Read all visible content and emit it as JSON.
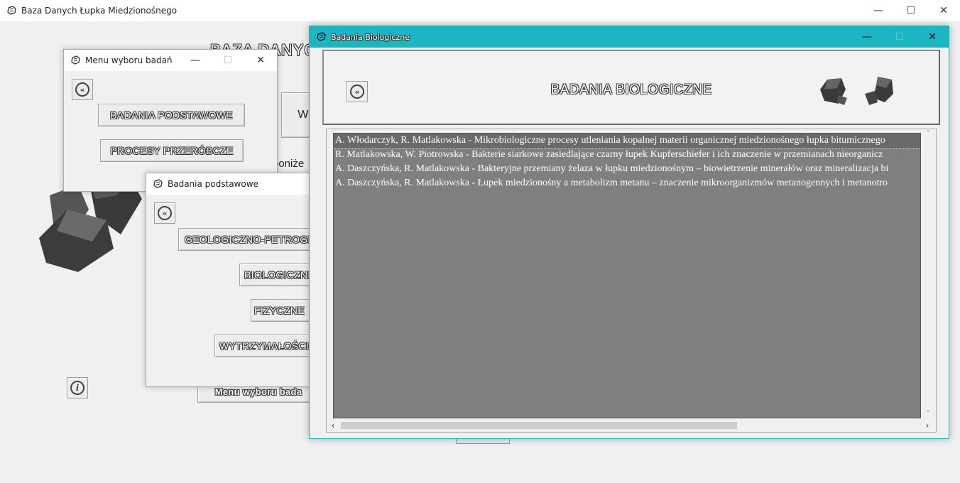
{
  "main_window": {
    "title": "Baza Danych Łupka Miedzionośnego",
    "heading_partial": "BAZA DANYCH",
    "hint_partial": "poniże",
    "button_partial_w": "W",
    "bottom_button_partial": "Menu wyboru bada"
  },
  "menu_window": {
    "title": "Menu wyboru badań",
    "btn_basic": "BADANIA PODSTAWOWE",
    "btn_processing": "PROCESY PRZERÓBCZE"
  },
  "basic_window": {
    "title": "Badania podstawowe",
    "btn_geo": "GEOLOGICZNO-PETROGRAFICZNE",
    "btn_bio": "BIOLOGICZNE",
    "btn_phys": "FIZYCZNE",
    "btn_strength": "WYTRZYMAŁOŚCIOWE"
  },
  "bio_window": {
    "title": "Badania Biologiczne",
    "header": "BADANIA BIOLOGICZNE",
    "accent_color": "#1ab6c4",
    "list_bg": "#7f7f7f",
    "items": [
      "A. Włodarczyk, R. Matlakowska - Mikrobiologiczne procesy utleniania kopalnej materii organicznej miedzionośnego łupka bitumicznego",
      "R. Matlakowska, W. Piotrowska - Bakterie siarkowe zasiedlające czarny łupek Kupferschiefer i ich znaczenie w przemianach nieorganicz",
      "A. Daszczyńska, R. Matlakowska - Bakteryjne przemiany żelaza w łupku miedzionośnym – biowietrzenie minerałów oraz mineralizacja bi",
      "A. Daszczyńska, R. Matlakowska - Łupek miedzionośny a metabolizm metanu – znaczenie mikroorganizmów metanogennych i metanotro"
    ]
  }
}
